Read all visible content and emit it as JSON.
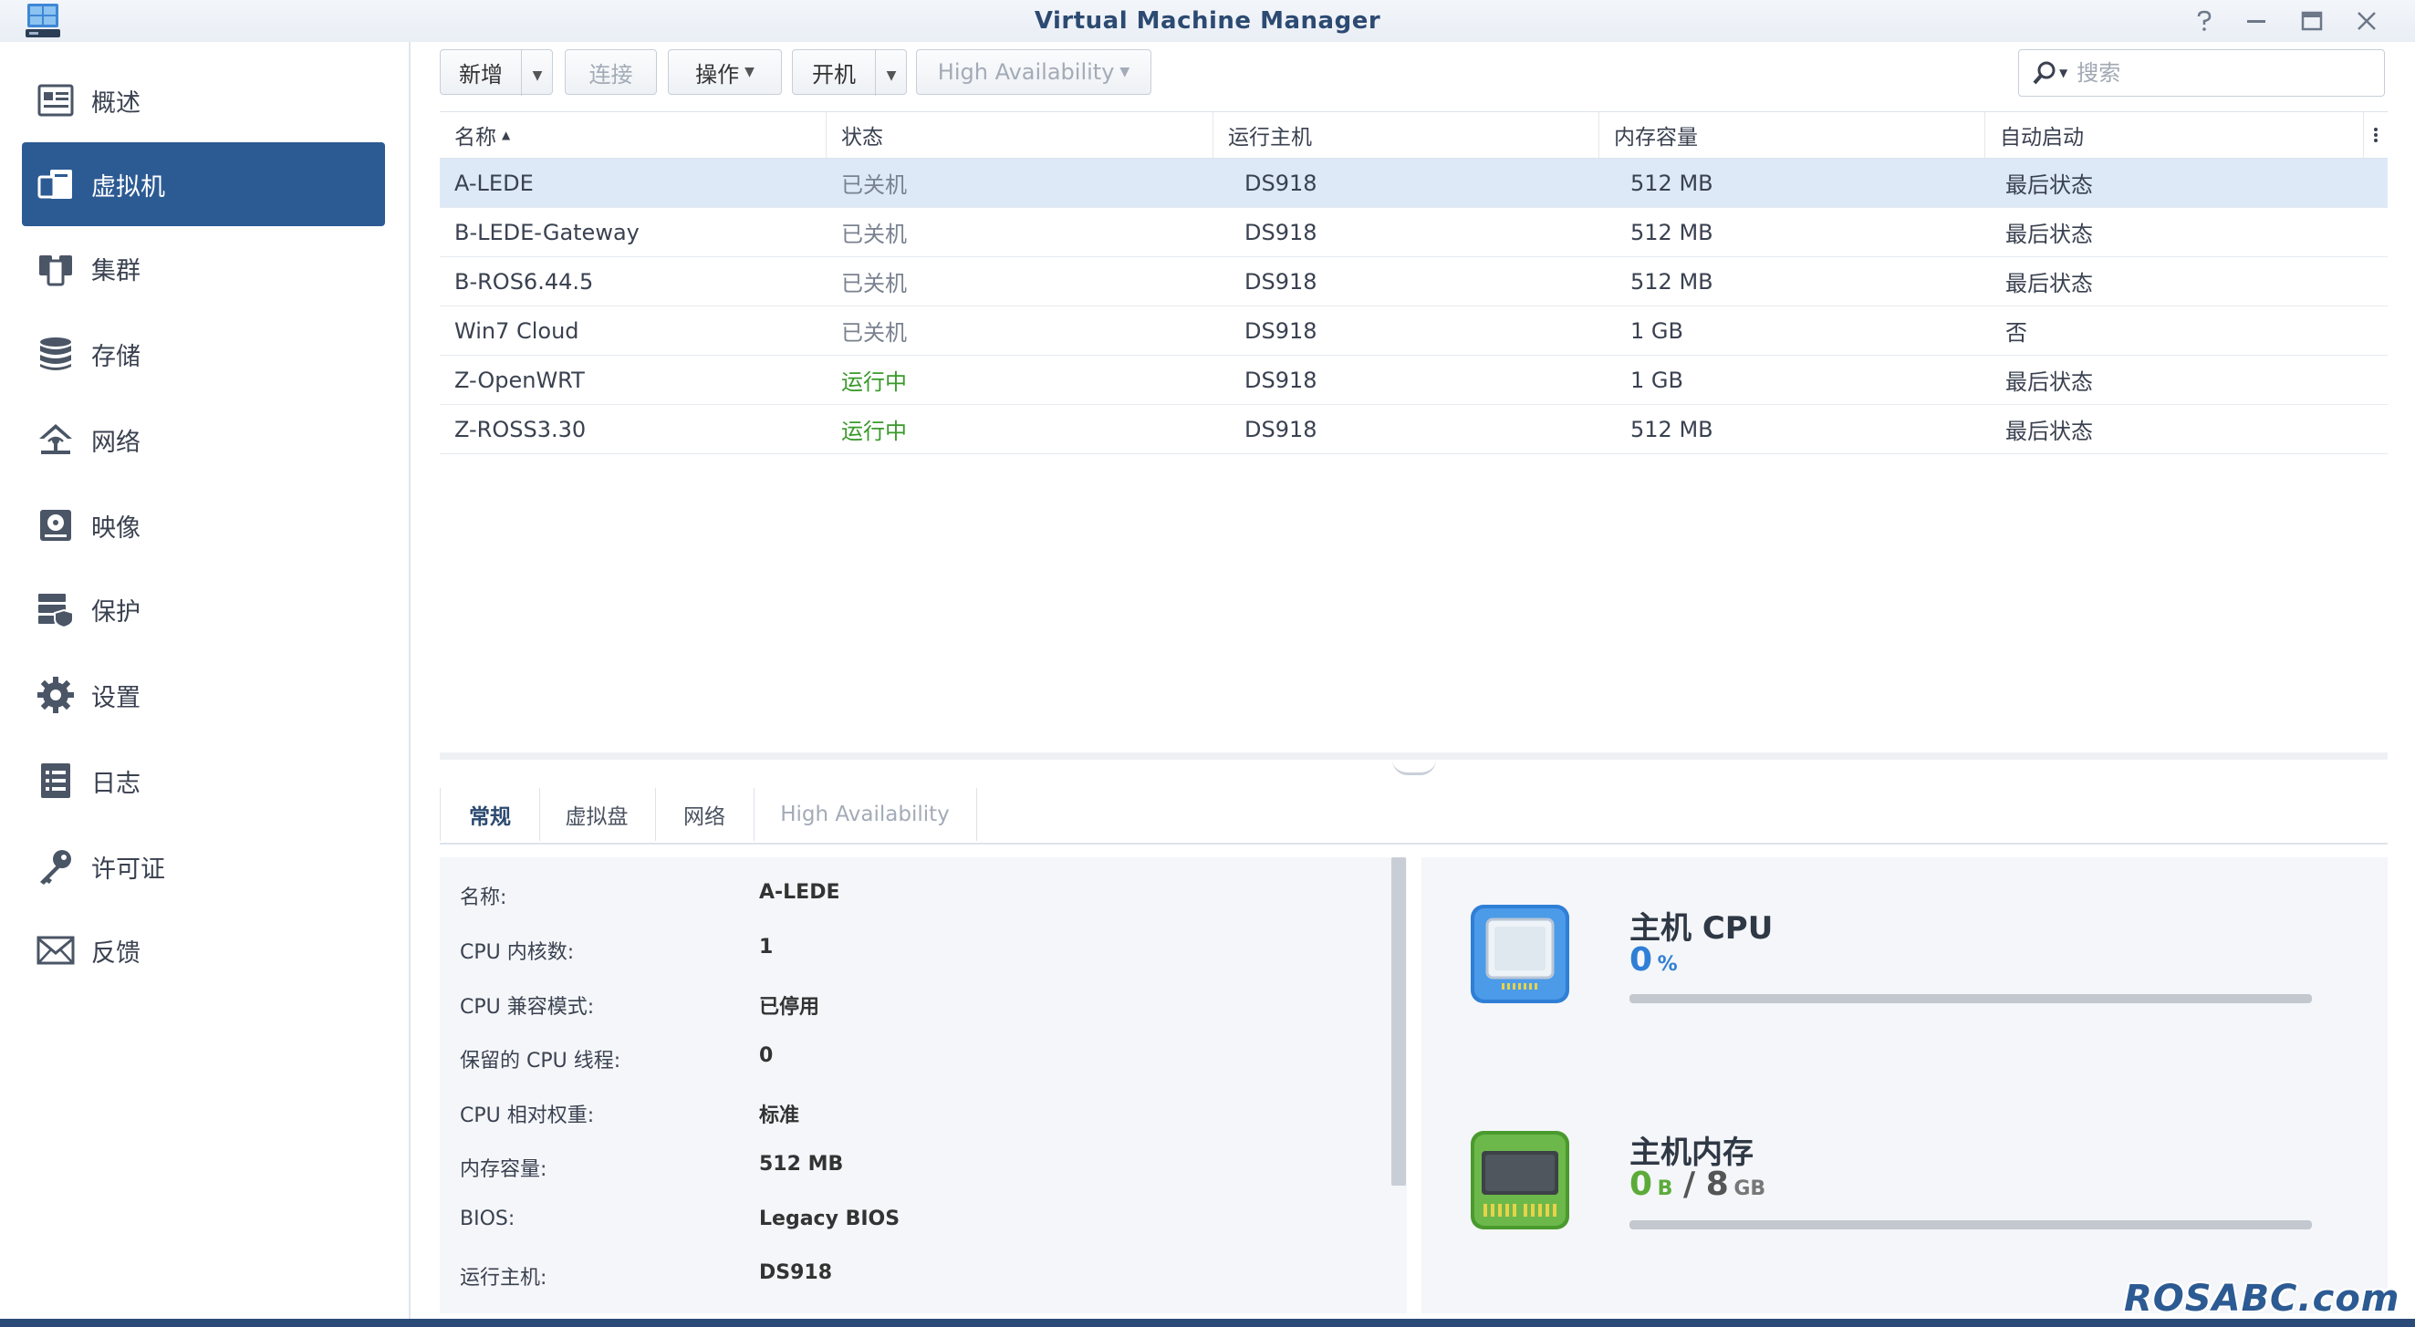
{
  "window": {
    "title": "Virtual Machine Manager"
  },
  "sidebar": {
    "items": [
      {
        "label": "概述",
        "icon": "overview-icon"
      },
      {
        "label": "虚拟机",
        "icon": "virtual-machine-icon",
        "active": true
      },
      {
        "label": "集群",
        "icon": "cluster-icon"
      },
      {
        "label": "存储",
        "icon": "storage-icon"
      },
      {
        "label": "网络",
        "icon": "network-icon"
      },
      {
        "label": "映像",
        "icon": "image-icon"
      },
      {
        "label": "保护",
        "icon": "protection-icon"
      },
      {
        "label": "设置",
        "icon": "settings-gear-icon"
      },
      {
        "label": "日志",
        "icon": "log-icon"
      },
      {
        "label": "许可证",
        "icon": "license-key-icon"
      },
      {
        "label": "反馈",
        "icon": "feedback-mail-icon"
      }
    ]
  },
  "toolbar": {
    "create": "新增",
    "connect": "连接",
    "action": "操作",
    "power_on": "开机",
    "high_availability": "High Availability"
  },
  "search": {
    "placeholder": "搜索"
  },
  "table": {
    "columns": [
      "名称",
      "状态",
      "运行主机",
      "内存容量",
      "自动启动"
    ],
    "sort_column": "名称",
    "rows": [
      {
        "name": "A-LEDE",
        "status": "已关机",
        "host": "DS918",
        "memory": "512 MB",
        "autostart": "最后状态",
        "running": false,
        "selected": true
      },
      {
        "name": "B-LEDE-Gateway",
        "status": "已关机",
        "host": "DS918",
        "memory": "512 MB",
        "autostart": "最后状态",
        "running": false
      },
      {
        "name": "B-ROS6.44.5",
        "status": "已关机",
        "host": "DS918",
        "memory": "512 MB",
        "autostart": "最后状态",
        "running": false
      },
      {
        "name": "Win7 Cloud",
        "status": "已关机",
        "host": "DS918",
        "memory": "1 GB",
        "autostart": "否",
        "running": false
      },
      {
        "name": "Z-OpenWRT",
        "status": "运行中",
        "host": "DS918",
        "memory": "1 GB",
        "autostart": "最后状态",
        "running": true
      },
      {
        "name": "Z-ROSS3.30",
        "status": "运行中",
        "host": "DS918",
        "memory": "512 MB",
        "autostart": "最后状态",
        "running": true
      }
    ]
  },
  "tabs": [
    {
      "label": "常规",
      "active": true
    },
    {
      "label": "虚拟盘"
    },
    {
      "label": "网络"
    },
    {
      "label": "High Availability",
      "disabled": true
    }
  ],
  "details": [
    {
      "label": "名称:",
      "value": "A-LEDE"
    },
    {
      "label": "CPU 内核数:",
      "value": "1"
    },
    {
      "label": "CPU 兼容模式:",
      "value": "已停用"
    },
    {
      "label": "保留的 CPU 线程:",
      "value": "0"
    },
    {
      "label": "CPU 相对权重:",
      "value": "标准"
    },
    {
      "label": "内存容量:",
      "value": "512 MB"
    },
    {
      "label": "BIOS:",
      "value": "Legacy BIOS"
    },
    {
      "label": "运行主机:",
      "value": "DS918"
    }
  ],
  "resources": {
    "cpu": {
      "title": "主机 CPU",
      "value": "0",
      "unit": "%",
      "usage": 0
    },
    "memory": {
      "title": "主机内存",
      "used": "0",
      "used_unit": "B",
      "separator": "/",
      "total": "8",
      "total_unit": "GB",
      "usage": 0
    }
  },
  "watermark": "ROSABC.com",
  "colors": {
    "accent": "#2c5a93",
    "running": "#3a9a2a",
    "selected_row": "#dde9f7",
    "cpu_value": "#2f7fd6",
    "memory_value": "#5cab3a"
  }
}
